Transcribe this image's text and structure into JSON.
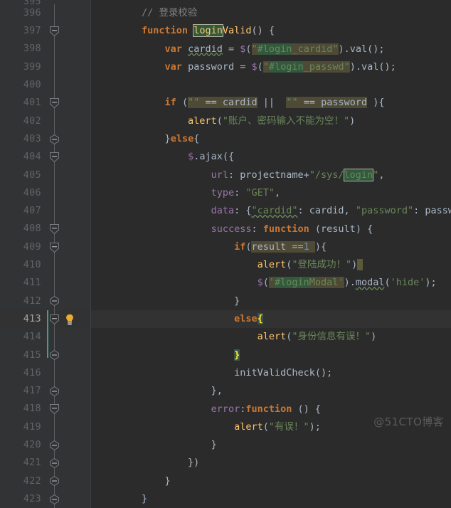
{
  "editor": {
    "theme_name": "darcula",
    "background": "#2b2b2b",
    "gutter_background": "#313335",
    "current_line_background": "#323232",
    "current_line_number": "413",
    "search_match_color": "#32593d",
    "brace_match_color": "#3b514d",
    "identifier_highlight_color": "#4e4a35",
    "change_marker_color": "#4a9a8a",
    "bulb_color": "#edab31",
    "first_visible_line": "395",
    "last_visible_line": "423"
  },
  "watermark": {
    "text": "@51CTO博客"
  },
  "icons": {
    "fold_collapse": "fold-collapse-icon",
    "fold_region_start": "fold-region-start-icon",
    "intention_bulb": "intention-bulb-icon"
  },
  "lines": [
    {
      "num": "395",
      "partial": true,
      "fold": "",
      "text": ""
    },
    {
      "num": "396",
      "partial": false,
      "fold": "",
      "text": "        // 登录校验"
    },
    {
      "num": "397",
      "partial": false,
      "fold": "start",
      "text": "        function loginValid() {"
    },
    {
      "num": "398",
      "partial": false,
      "fold": "",
      "text": "            var cardid = $(\"#login_cardid\").val();"
    },
    {
      "num": "399",
      "partial": false,
      "fold": "",
      "text": "            var password = $(\"#login_passwd\").val();"
    },
    {
      "num": "400",
      "partial": false,
      "fold": "",
      "text": ""
    },
    {
      "num": "401",
      "partial": false,
      "fold": "start",
      "text": "            if (\"\" == cardid ||  \"\" == password ){"
    },
    {
      "num": "402",
      "partial": false,
      "fold": "",
      "text": "                alert(\"账户、密码输入不能为空！\")"
    },
    {
      "num": "403",
      "partial": false,
      "fold": "end",
      "text": "            }else{"
    },
    {
      "num": "404",
      "partial": false,
      "fold": "start",
      "text": "                $.ajax({"
    },
    {
      "num": "405",
      "partial": false,
      "fold": "",
      "text": "                    url: projectname+\"/sys/login\","
    },
    {
      "num": "406",
      "partial": false,
      "fold": "",
      "text": "                    type: \"GET\","
    },
    {
      "num": "407",
      "partial": false,
      "fold": "",
      "text": "                    data: {\"cardid\": cardid, \"password\": password },"
    },
    {
      "num": "408",
      "partial": false,
      "fold": "start",
      "text": "                    success: function (result) {"
    },
    {
      "num": "409",
      "partial": false,
      "fold": "start",
      "text": "                        if(result ==1 ){"
    },
    {
      "num": "410",
      "partial": false,
      "fold": "",
      "text": "                            alert(\"登陆成功！\")"
    },
    {
      "num": "411",
      "partial": false,
      "fold": "",
      "text": "                            $('#loginModal').modal('hide');"
    },
    {
      "num": "412",
      "partial": false,
      "fold": "end",
      "text": "                        }"
    },
    {
      "num": "413",
      "partial": false,
      "fold": "start",
      "text": "                        else{"
    },
    {
      "num": "414",
      "partial": false,
      "fold": "",
      "text": "                            alert(\"身份信息有误！\")"
    },
    {
      "num": "415",
      "partial": false,
      "fold": "end",
      "text": "                        }"
    },
    {
      "num": "416",
      "partial": false,
      "fold": "",
      "text": "                        initValidCheck();"
    },
    {
      "num": "417",
      "partial": false,
      "fold": "end",
      "text": "                    },"
    },
    {
      "num": "418",
      "partial": false,
      "fold": "start",
      "text": "                    error:function () {"
    },
    {
      "num": "419",
      "partial": false,
      "fold": "",
      "text": "                        alert(\"有误！\");"
    },
    {
      "num": "420",
      "partial": false,
      "fold": "end",
      "text": "                    }"
    },
    {
      "num": "421",
      "partial": false,
      "fold": "end",
      "text": "                })"
    },
    {
      "num": "422",
      "partial": false,
      "fold": "end",
      "text": "            }"
    },
    {
      "num": "423",
      "partial": false,
      "fold": "end",
      "text": "        }"
    }
  ],
  "annotations": {
    "search_query": "login",
    "search_matches": [
      {
        "line": "397",
        "text": "login",
        "current": true
      },
      {
        "line": "398",
        "text": "login",
        "current": false
      },
      {
        "line": "399",
        "text": "login",
        "current": false
      },
      {
        "line": "405",
        "text": "login",
        "current": true
      },
      {
        "line": "411",
        "text": "login",
        "current": false
      }
    ],
    "brace_match_lines": [
      "413",
      "415"
    ],
    "caret_line": "410",
    "change_marker_lines": [
      "413",
      "414",
      "415"
    ],
    "intention_bulb_line": "413"
  }
}
